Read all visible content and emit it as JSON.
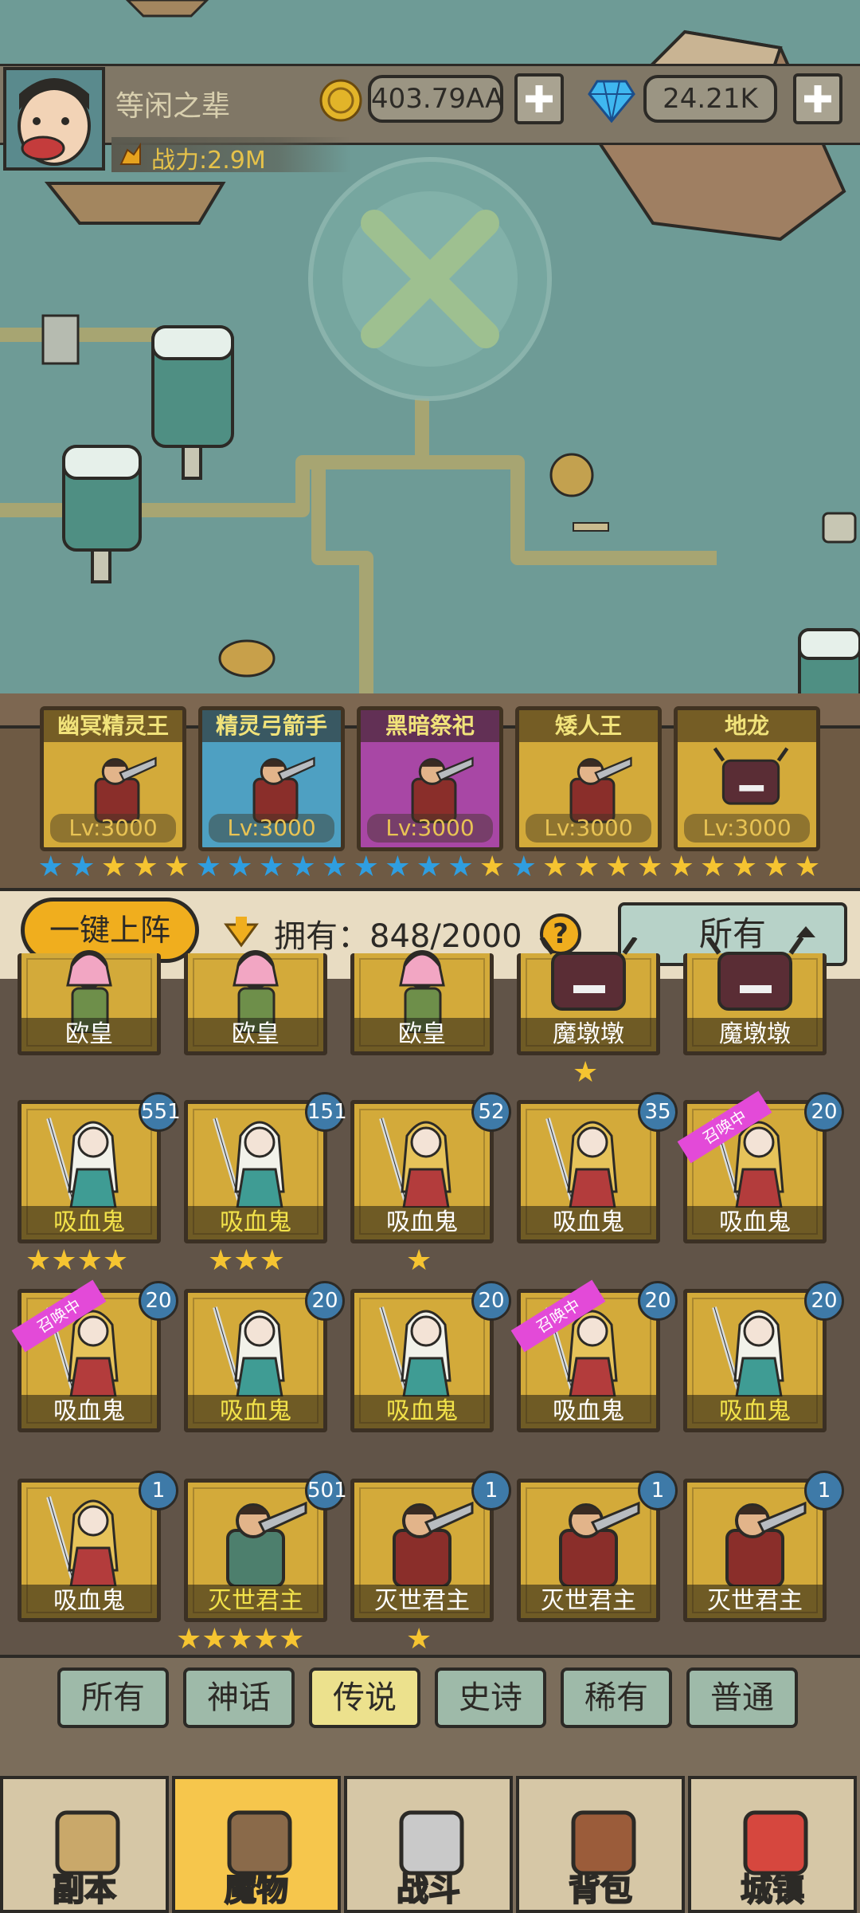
{
  "player": {
    "name": "等闲之辈",
    "power": "战力:2.9M"
  },
  "resources": {
    "gold": "403.79AA",
    "gems": "24.21K"
  },
  "formation": [
    {
      "name": "幽冥精灵王",
      "level": "Lv:3000",
      "color": "#d3aa3a"
    },
    {
      "name": "精灵弓箭手",
      "level": "Lv:3000",
      "color": "#4ea0c2"
    },
    {
      "name": "黑暗祭祀",
      "level": "Lv:3000",
      "color": "#a847a5"
    },
    {
      "name": "矮人王",
      "level": "Lv:3000",
      "color": "#d3aa3a"
    },
    {
      "name": "地龙",
      "level": "Lv:3000",
      "color": "#d3aa3a"
    }
  ],
  "formation_stars": {
    "colors": [
      "blue",
      "blue",
      "gold",
      "gold",
      "gold",
      "blue",
      "blue",
      "blue",
      "blue",
      "blue",
      "blue",
      "blue",
      "blue",
      "blue",
      "gold",
      "blue",
      "gold",
      "gold",
      "gold",
      "gold",
      "gold",
      "gold",
      "gold",
      "gold",
      "gold"
    ],
    "blue_hex": "#2f9ee0",
    "gold_hex": "#f5c431"
  },
  "controls": {
    "auto_deploy": "一键上阵",
    "owned_label": "拥有：",
    "owned_value": "848/2000",
    "help": "?",
    "filter": "所有"
  },
  "monsters": [
    {
      "name": "欧皇",
      "gold": false
    },
    {
      "name": "欧皇",
      "gold": false
    },
    {
      "name": "欧皇",
      "gold": false
    },
    {
      "name": "魔墩墩",
      "gold": false,
      "stars": 1
    },
    {
      "name": "魔墩墩",
      "gold": false
    },
    {
      "name": "吸血鬼",
      "gold": true,
      "count": "551",
      "stars": 4,
      "hair": "white"
    },
    {
      "name": "吸血鬼",
      "gold": true,
      "count": "151",
      "stars": 3,
      "hair": "white"
    },
    {
      "name": "吸血鬼",
      "gold": false,
      "count": "52",
      "stars": 1,
      "hair": "blonde"
    },
    {
      "name": "吸血鬼",
      "gold": false,
      "count": "35",
      "hair": "blonde"
    },
    {
      "name": "吸血鬼",
      "gold": false,
      "count": "20",
      "ribbon": "召唤中",
      "hair": "blonde"
    },
    {
      "name": "吸血鬼",
      "gold": false,
      "count": "20",
      "ribbon": "召唤中",
      "hair": "blonde"
    },
    {
      "name": "吸血鬼",
      "gold": true,
      "count": "20",
      "hair": "white"
    },
    {
      "name": "吸血鬼",
      "gold": true,
      "count": "20",
      "hair": "white"
    },
    {
      "name": "吸血鬼",
      "gold": false,
      "count": "20",
      "ribbon": "召唤中",
      "hair": "blonde"
    },
    {
      "name": "吸血鬼",
      "gold": true,
      "count": "20",
      "hair": "white"
    },
    {
      "name": "吸血鬼",
      "gold": false,
      "count": "1",
      "hair": "blonde"
    },
    {
      "name": "灭世君主",
      "gold": true,
      "count": "501",
      "stars": 5,
      "kind": "king"
    },
    {
      "name": "灭世君主",
      "gold": false,
      "count": "1",
      "stars": 1,
      "kind": "king2"
    },
    {
      "name": "灭世君主",
      "gold": false,
      "count": "1",
      "kind": "king2"
    },
    {
      "name": "灭世君主",
      "gold": false,
      "count": "1",
      "kind": "king2"
    }
  ],
  "rarity_tabs": [
    "所有",
    "神话",
    "传说",
    "史诗",
    "稀有",
    "普通"
  ],
  "active_rarity": 2,
  "nav": [
    "副本",
    "魔物",
    "战斗",
    "背包",
    "城镇"
  ],
  "active_nav": 1
}
